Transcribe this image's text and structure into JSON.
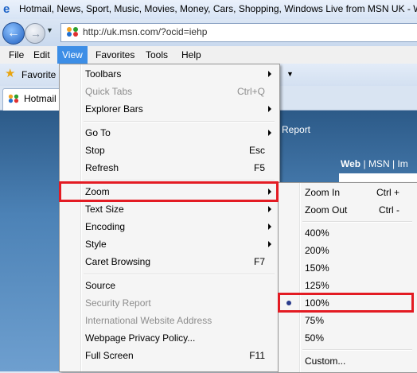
{
  "window": {
    "title": "Hotmail, News, Sport, Music, Movies, Money, Cars, Shopping, Windows Live from MSN UK - W",
    "address": "http://uk.msn.com/?ocid=iehp"
  },
  "menubar": [
    "File",
    "Edit",
    "View",
    "Favorites",
    "Tools",
    "Help"
  ],
  "favorites_label": "Favorite",
  "tab": {
    "label": "Hotmail"
  },
  "page": {
    "report_text": "Report",
    "search_tab_web": "Web",
    "search_tab_sep1": "|",
    "search_tab_msn": "MSN",
    "search_tab_sep2": "|",
    "search_tab_im": "Im"
  },
  "view_menu": {
    "items": [
      {
        "label": "Toolbars",
        "shortcut": "",
        "submenu": true,
        "disabled": false
      },
      {
        "label": "Quick Tabs",
        "shortcut": "Ctrl+Q",
        "submenu": false,
        "disabled": true
      },
      {
        "label": "Explorer Bars",
        "shortcut": "",
        "submenu": true,
        "disabled": false
      },
      {
        "label": "Go To",
        "shortcut": "",
        "submenu": true,
        "disabled": false
      },
      {
        "label": "Stop",
        "shortcut": "Esc",
        "submenu": false,
        "disabled": false
      },
      {
        "label": "Refresh",
        "shortcut": "F5",
        "submenu": false,
        "disabled": false
      },
      {
        "label": "Zoom",
        "shortcut": "",
        "submenu": true,
        "disabled": false
      },
      {
        "label": "Text Size",
        "shortcut": "",
        "submenu": true,
        "disabled": false
      },
      {
        "label": "Encoding",
        "shortcut": "",
        "submenu": true,
        "disabled": false
      },
      {
        "label": "Style",
        "shortcut": "",
        "submenu": true,
        "disabled": false
      },
      {
        "label": "Caret Browsing",
        "shortcut": "F7",
        "submenu": false,
        "disabled": false
      },
      {
        "label": "Source",
        "shortcut": "",
        "submenu": false,
        "disabled": false
      },
      {
        "label": "Security Report",
        "shortcut": "",
        "submenu": false,
        "disabled": true
      },
      {
        "label": "International Website Address",
        "shortcut": "",
        "submenu": false,
        "disabled": true
      },
      {
        "label": "Webpage Privacy Policy...",
        "shortcut": "",
        "submenu": false,
        "disabled": false
      },
      {
        "label": "Full Screen",
        "shortcut": "F11",
        "submenu": false,
        "disabled": false
      }
    ]
  },
  "zoom_menu": {
    "items": [
      {
        "label": "Zoom In",
        "shortcut": "Ctrl +",
        "checked": false
      },
      {
        "label": "Zoom Out",
        "shortcut": "Ctrl -",
        "checked": false
      },
      {
        "label": "400%",
        "shortcut": "",
        "checked": false
      },
      {
        "label": "200%",
        "shortcut": "",
        "checked": false
      },
      {
        "label": "150%",
        "shortcut": "",
        "checked": false
      },
      {
        "label": "125%",
        "shortcut": "",
        "checked": false
      },
      {
        "label": "100%",
        "shortcut": "",
        "checked": true
      },
      {
        "label": "75%",
        "shortcut": "",
        "checked": false
      },
      {
        "label": "50%",
        "shortcut": "",
        "checked": false
      },
      {
        "label": "Custom...",
        "shortcut": "",
        "checked": false
      }
    ]
  },
  "colors": {
    "highlight_box": "#e31b23",
    "menu_active": "#3d8ee6"
  }
}
